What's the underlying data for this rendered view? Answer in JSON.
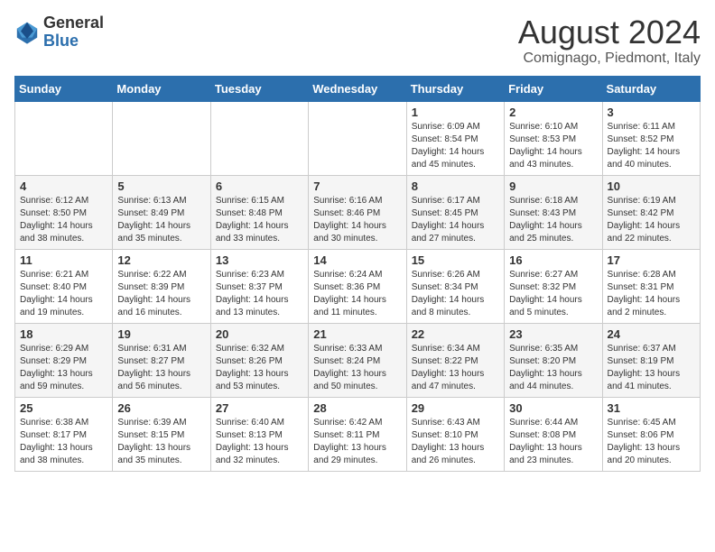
{
  "header": {
    "logo_general": "General",
    "logo_blue": "Blue",
    "month_year": "August 2024",
    "location": "Comignago, Piedmont, Italy"
  },
  "calendar": {
    "days_of_week": [
      "Sunday",
      "Monday",
      "Tuesday",
      "Wednesday",
      "Thursday",
      "Friday",
      "Saturday"
    ],
    "weeks": [
      [
        {
          "day": "",
          "info": ""
        },
        {
          "day": "",
          "info": ""
        },
        {
          "day": "",
          "info": ""
        },
        {
          "day": "",
          "info": ""
        },
        {
          "day": "1",
          "info": "Sunrise: 6:09 AM\nSunset: 8:54 PM\nDaylight: 14 hours\nand 45 minutes."
        },
        {
          "day": "2",
          "info": "Sunrise: 6:10 AM\nSunset: 8:53 PM\nDaylight: 14 hours\nand 43 minutes."
        },
        {
          "day": "3",
          "info": "Sunrise: 6:11 AM\nSunset: 8:52 PM\nDaylight: 14 hours\nand 40 minutes."
        }
      ],
      [
        {
          "day": "4",
          "info": "Sunrise: 6:12 AM\nSunset: 8:50 PM\nDaylight: 14 hours\nand 38 minutes."
        },
        {
          "day": "5",
          "info": "Sunrise: 6:13 AM\nSunset: 8:49 PM\nDaylight: 14 hours\nand 35 minutes."
        },
        {
          "day": "6",
          "info": "Sunrise: 6:15 AM\nSunset: 8:48 PM\nDaylight: 14 hours\nand 33 minutes."
        },
        {
          "day": "7",
          "info": "Sunrise: 6:16 AM\nSunset: 8:46 PM\nDaylight: 14 hours\nand 30 minutes."
        },
        {
          "day": "8",
          "info": "Sunrise: 6:17 AM\nSunset: 8:45 PM\nDaylight: 14 hours\nand 27 minutes."
        },
        {
          "day": "9",
          "info": "Sunrise: 6:18 AM\nSunset: 8:43 PM\nDaylight: 14 hours\nand 25 minutes."
        },
        {
          "day": "10",
          "info": "Sunrise: 6:19 AM\nSunset: 8:42 PM\nDaylight: 14 hours\nand 22 minutes."
        }
      ],
      [
        {
          "day": "11",
          "info": "Sunrise: 6:21 AM\nSunset: 8:40 PM\nDaylight: 14 hours\nand 19 minutes."
        },
        {
          "day": "12",
          "info": "Sunrise: 6:22 AM\nSunset: 8:39 PM\nDaylight: 14 hours\nand 16 minutes."
        },
        {
          "day": "13",
          "info": "Sunrise: 6:23 AM\nSunset: 8:37 PM\nDaylight: 14 hours\nand 13 minutes."
        },
        {
          "day": "14",
          "info": "Sunrise: 6:24 AM\nSunset: 8:36 PM\nDaylight: 14 hours\nand 11 minutes."
        },
        {
          "day": "15",
          "info": "Sunrise: 6:26 AM\nSunset: 8:34 PM\nDaylight: 14 hours\nand 8 minutes."
        },
        {
          "day": "16",
          "info": "Sunrise: 6:27 AM\nSunset: 8:32 PM\nDaylight: 14 hours\nand 5 minutes."
        },
        {
          "day": "17",
          "info": "Sunrise: 6:28 AM\nSunset: 8:31 PM\nDaylight: 14 hours\nand 2 minutes."
        }
      ],
      [
        {
          "day": "18",
          "info": "Sunrise: 6:29 AM\nSunset: 8:29 PM\nDaylight: 13 hours\nand 59 minutes."
        },
        {
          "day": "19",
          "info": "Sunrise: 6:31 AM\nSunset: 8:27 PM\nDaylight: 13 hours\nand 56 minutes."
        },
        {
          "day": "20",
          "info": "Sunrise: 6:32 AM\nSunset: 8:26 PM\nDaylight: 13 hours\nand 53 minutes."
        },
        {
          "day": "21",
          "info": "Sunrise: 6:33 AM\nSunset: 8:24 PM\nDaylight: 13 hours\nand 50 minutes."
        },
        {
          "day": "22",
          "info": "Sunrise: 6:34 AM\nSunset: 8:22 PM\nDaylight: 13 hours\nand 47 minutes."
        },
        {
          "day": "23",
          "info": "Sunrise: 6:35 AM\nSunset: 8:20 PM\nDaylight: 13 hours\nand 44 minutes."
        },
        {
          "day": "24",
          "info": "Sunrise: 6:37 AM\nSunset: 8:19 PM\nDaylight: 13 hours\nand 41 minutes."
        }
      ],
      [
        {
          "day": "25",
          "info": "Sunrise: 6:38 AM\nSunset: 8:17 PM\nDaylight: 13 hours\nand 38 minutes."
        },
        {
          "day": "26",
          "info": "Sunrise: 6:39 AM\nSunset: 8:15 PM\nDaylight: 13 hours\nand 35 minutes."
        },
        {
          "day": "27",
          "info": "Sunrise: 6:40 AM\nSunset: 8:13 PM\nDaylight: 13 hours\nand 32 minutes."
        },
        {
          "day": "28",
          "info": "Sunrise: 6:42 AM\nSunset: 8:11 PM\nDaylight: 13 hours\nand 29 minutes."
        },
        {
          "day": "29",
          "info": "Sunrise: 6:43 AM\nSunset: 8:10 PM\nDaylight: 13 hours\nand 26 minutes."
        },
        {
          "day": "30",
          "info": "Sunrise: 6:44 AM\nSunset: 8:08 PM\nDaylight: 13 hours\nand 23 minutes."
        },
        {
          "day": "31",
          "info": "Sunrise: 6:45 AM\nSunset: 8:06 PM\nDaylight: 13 hours\nand 20 minutes."
        }
      ]
    ]
  }
}
